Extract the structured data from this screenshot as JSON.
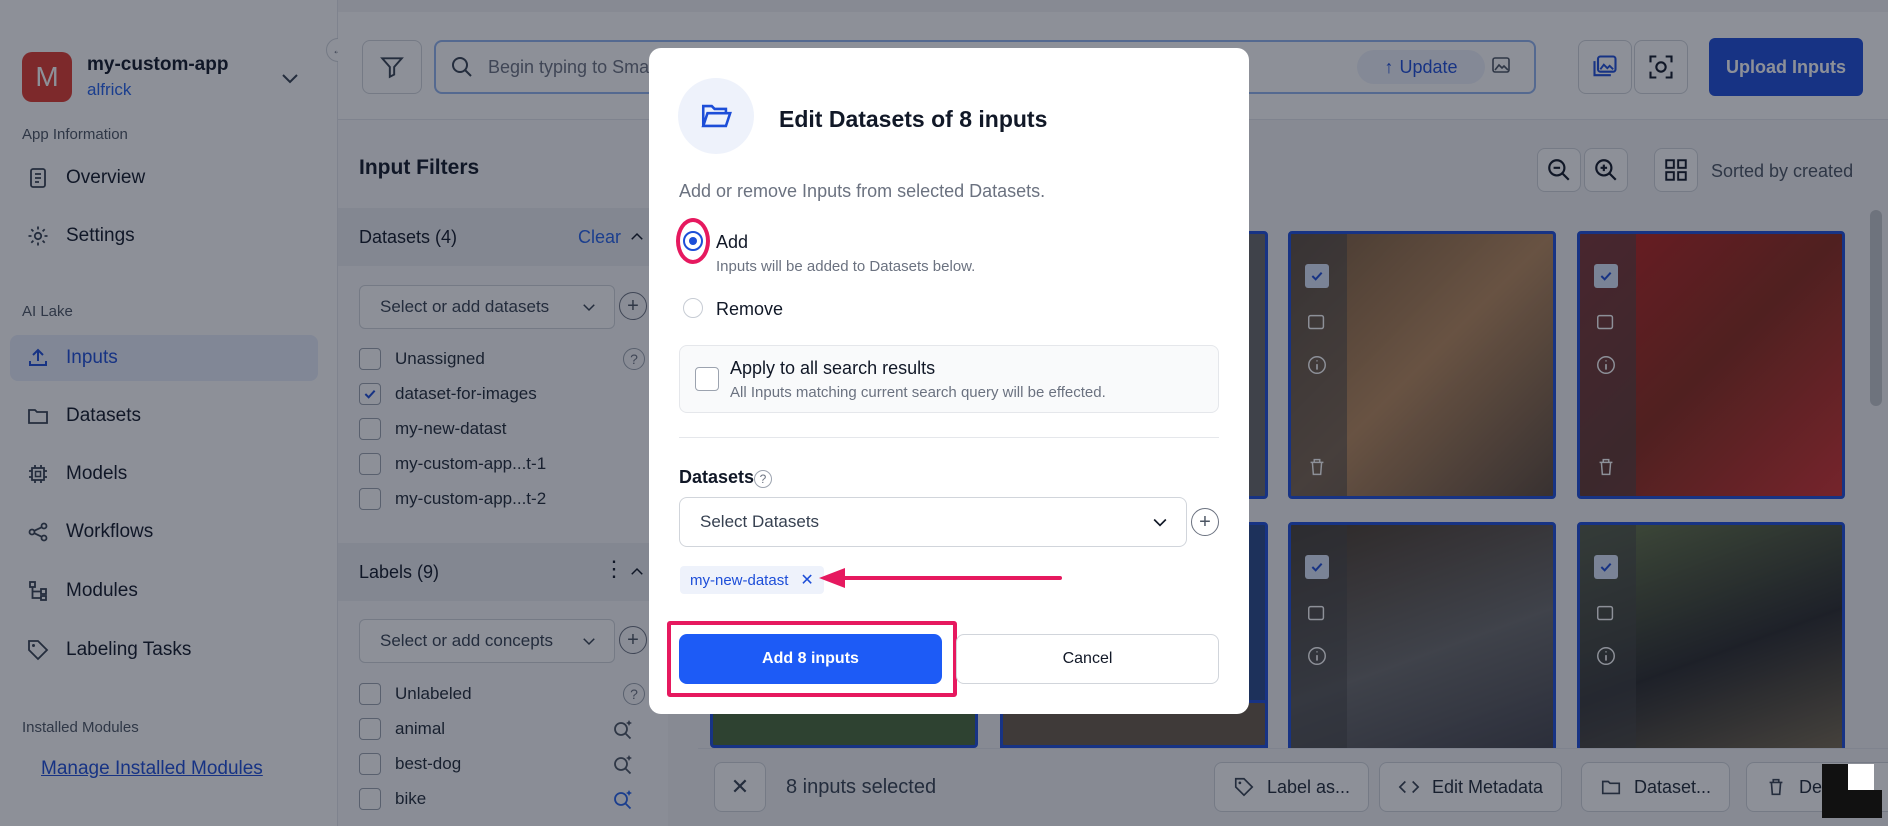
{
  "sidebar": {
    "app_initial": "M",
    "app_name": "my-custom-app",
    "app_user": "alfrick",
    "section_app_info": "App Information",
    "section_ai_lake": "AI Lake",
    "section_installed": "Installed Modules",
    "items": [
      {
        "label": "Overview",
        "icon": "document-icon"
      },
      {
        "label": "Settings",
        "icon": "gear-icon"
      },
      {
        "label": "Inputs",
        "icon": "upload-icon",
        "active": true
      },
      {
        "label": "Datasets",
        "icon": "folder-icon"
      },
      {
        "label": "Models",
        "icon": "chip-icon"
      },
      {
        "label": "Workflows",
        "icon": "share-icon"
      },
      {
        "label": "Modules",
        "icon": "tree-icon"
      },
      {
        "label": "Labeling Tasks",
        "icon": "tag-icon"
      }
    ],
    "manage_link": "Manage Installed Modules"
  },
  "filters": {
    "title": "Input Filters",
    "datasets_header": "Datasets (4)",
    "clear": "Clear",
    "datasets_placeholder": "Select or add datasets",
    "datasets": [
      {
        "label": "Unassigned",
        "checked": false
      },
      {
        "label": "dataset-for-images",
        "checked": true
      },
      {
        "label": "my-new-datast",
        "checked": false
      },
      {
        "label": "my-custom-app...t-1",
        "checked": false
      },
      {
        "label": "my-custom-app...t-2",
        "checked": false
      }
    ],
    "labels_header": "Labels (9)",
    "labels_placeholder": "Select or add concepts",
    "labels": [
      {
        "label": "Unlabeled"
      },
      {
        "label": "animal"
      },
      {
        "label": "best-dog"
      },
      {
        "label": "bike"
      }
    ]
  },
  "topbar": {
    "search_placeholder": "Begin typing to Smar",
    "update_label": "Update",
    "upload_label": "Upload Inputs"
  },
  "grid": {
    "sorted_label": "Sorted by created"
  },
  "selection_bar": {
    "count": "8 inputs selected",
    "label_as": "Label as...",
    "edit_metadata": "Edit Metadata",
    "datasets": "Dataset...",
    "delete": "De"
  },
  "modal": {
    "title": "Edit Datasets of 8 inputs",
    "subtitle": "Add or remove Inputs from selected Datasets.",
    "add_label": "Add",
    "add_desc": "Inputs will be added to Datasets below.",
    "remove_label": "Remove",
    "apply_label": "Apply to all search results",
    "apply_desc": "All Inputs matching current search query will be effected.",
    "datasets_label": "Datasets",
    "select_placeholder": "Select Datasets",
    "chip": "my-new-datast",
    "add_button": "Add 8 inputs",
    "cancel_button": "Cancel"
  },
  "colors": {
    "accent": "#1d4ed8",
    "annotation": "#e6195f",
    "app_avatar": "#e03a2f"
  }
}
